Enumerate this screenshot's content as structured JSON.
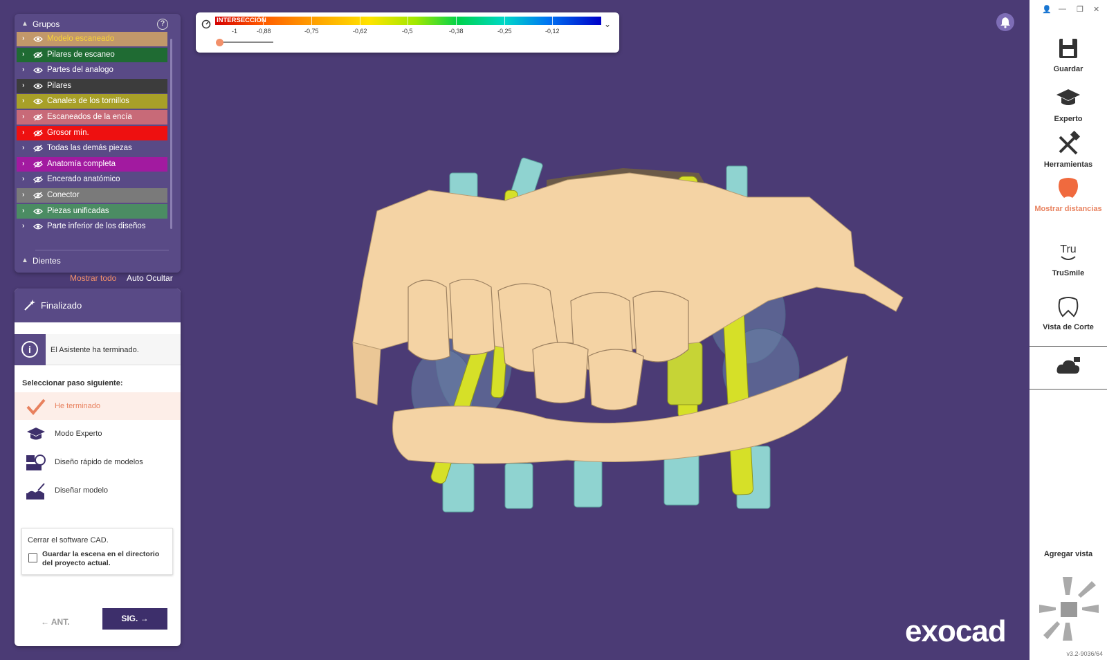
{
  "groups_panel": {
    "title": "Grupos",
    "help": "?",
    "items": [
      {
        "label": "Modelo escaneado",
        "bg": "#c2986a",
        "text_color": "#f7d23a",
        "visible": true
      },
      {
        "label": "Pilares de escaneo",
        "bg": "#1f6b33",
        "text_color": "#ffffff",
        "visible": false
      },
      {
        "label": "Partes del analogo",
        "bg": "#594a86",
        "text_color": "#ffffff",
        "visible": true
      },
      {
        "label": "Pilares",
        "bg": "#3c3c3c",
        "text_color": "#ffffff",
        "visible": true
      },
      {
        "label": "Canales de los tornillos",
        "bg": "#a8a028",
        "text_color": "#ffffff",
        "visible": true
      },
      {
        "label": "Escaneados de la encía",
        "bg": "#c86a78",
        "text_color": "#ffffff",
        "visible": false
      },
      {
        "label": "Grosor mín.",
        "bg": "#ee1010",
        "text_color": "#ffffff",
        "visible": false
      },
      {
        "label": "Todas las demás piezas",
        "bg": "#594a86",
        "text_color": "#ffffff",
        "visible": false
      },
      {
        "label": "Anatomía completa",
        "bg": "#a21aa0",
        "text_color": "#ffffff",
        "visible": false
      },
      {
        "label": "Encerado anatómico",
        "bg": "#594a86",
        "text_color": "#ffffff",
        "visible": false
      },
      {
        "label": "Conector",
        "bg": "#7a7a7a",
        "text_color": "#ffffff",
        "visible": false
      },
      {
        "label": "Piezas unificadas",
        "bg": "#4b8c63",
        "text_color": "#ffffff",
        "visible": true
      },
      {
        "label": "Parte inferior de los diseños",
        "bg": "#594a86",
        "text_color": "#ffffff",
        "visible": true
      }
    ],
    "teeth_label": "Dientes",
    "show_all": "Mostrar todo",
    "auto_hide": "Auto Ocultar"
  },
  "color_scale": {
    "title": "INTERSECCIÓN",
    "labels": [
      "-1",
      "-0,88",
      "-0,75",
      "-0,62",
      "-0,5",
      "-0,38",
      "-0,25",
      "-0,12"
    ],
    "slider_value": 0
  },
  "wizard": {
    "title": "Finalizado",
    "info": "El Asistente ha terminado.",
    "next_step_label": "Seleccionar paso siguiente:",
    "options": [
      {
        "label": "He terminado",
        "selected": true,
        "icon": "check-icon"
      },
      {
        "label": "Modo Experto",
        "selected": false,
        "icon": "graduation-cap-icon"
      },
      {
        "label": "Diseño rápido de modelos",
        "selected": false,
        "icon": "quick-model-icon"
      },
      {
        "label": "Diseñar modelo",
        "selected": false,
        "icon": "design-model-icon"
      }
    ],
    "close_cad": "Cerrar el software CAD.",
    "save_scene": "Guardar la escena en el directorio del proyecto actual.",
    "save_scene_checked": false,
    "prev": "ANT.",
    "next": "SIG."
  },
  "toolbar": {
    "items": [
      {
        "label": "Guardar",
        "icon": "save-icon"
      },
      {
        "label": "Experto",
        "icon": "graduation-cap-icon"
      },
      {
        "label": "Herramientas",
        "icon": "tools-icon"
      },
      {
        "label": "Mostrar distancias",
        "icon": "distance-tooth-icon",
        "active": true
      },
      {
        "label": "TruSmile",
        "icon": "trusmile-icon"
      },
      {
        "label": "Vista de Corte",
        "icon": "section-view-icon"
      }
    ],
    "add_view": "Agregar vista",
    "version": "v3.2-9036/64"
  },
  "brand": "exocad",
  "colors": {
    "background": "#4b3b75",
    "accent": "#e8815e",
    "panel": "#594a86",
    "dark_button": "#3d2f6b"
  }
}
